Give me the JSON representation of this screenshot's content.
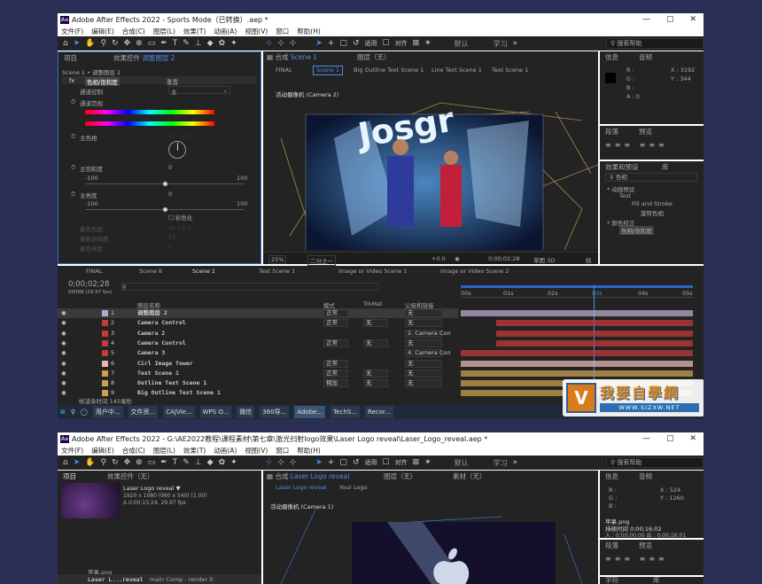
{
  "win1": {
    "title": "Adobe After Effects 2022 - Sports Mode（已转换）.aep *",
    "app_icon": "Ae",
    "menu": [
      "文件(F)",
      "编辑(E)",
      "合成(C)",
      "图层(L)",
      "效果(T)",
      "动画(A)",
      "视图(V)",
      "窗口",
      "帮助(H)"
    ],
    "win_buttons": [
      "—",
      "▢",
      "✕"
    ],
    "toolbar": {
      "snap_label": "对齐",
      "align_label": "适用",
      "workspaces": [
        "默认",
        "学习"
      ],
      "search_placeholder": "搜索帮助"
    },
    "fx_panel": {
      "tabs": [
        "项目",
        "效果控件",
        "调整图层 2"
      ],
      "breadcrumb": "Scene 1 • 调整图层 2",
      "effect_name": "色相/饱和度",
      "reset": "重置",
      "channel_control_label": "通道控制",
      "channel_control_value": "主",
      "channel_range_label": "通道范围",
      "master_hue_label": "主色相",
      "master_hue_value": "0x +0.0°",
      "master_sat_label": "主饱和度",
      "master_sat_value": "0",
      "sat_min": "-100",
      "sat_max": "100",
      "master_light_label": "主亮度",
      "master_light_value": "0",
      "light_min": "-100",
      "light_max": "100",
      "colorize_label": "彩色化",
      "colorize_hue_label": "着色色相",
      "colorize_hue_value": "0x +0.0°",
      "colorize_sat_label": "着色饱和度",
      "colorize_sat_value": "25",
      "colorize_light_label": "着色亮度",
      "colorize_light_value": "0"
    },
    "comp": {
      "header": "合成",
      "header_comp": "Scene 1",
      "layer_label": "图层（无）",
      "tabs": [
        "FINAL",
        "Scene 1",
        "Big Outline Text Scene 1",
        "Line Text Scene 1",
        "Text Scene 1"
      ],
      "camera_label": "活动摄像机 (Camera 2)",
      "zoom": "25%",
      "quality": "二分之一",
      "offset": "+0.0",
      "timecode": "0;00;02;28",
      "draft": "草图 3D",
      "last": "经"
    },
    "info": {
      "tabs": [
        "信息",
        "音频"
      ],
      "R": "R :",
      "G": "G :",
      "B": "B :",
      "A": "A : 0",
      "X": "X : 3192",
      "Y": "Y : 344"
    },
    "para": {
      "tabs": [
        "段落",
        "预览"
      ]
    },
    "effects": {
      "tabs": [
        "效果和预设",
        "库"
      ],
      "search": "色相",
      "items": [
        "* 动画预设",
        "Text",
        "Fill and Stroke",
        "旋转色相",
        "* 颜色校正",
        "色相/饱和度"
      ]
    },
    "timeline": {
      "tabs": [
        "FINAL",
        "Scene 8",
        "Scene 1",
        "Text Scene 1",
        "Image or Video Scene 1",
        "Image or Video Scene 2"
      ],
      "timecode": "0;00;02;28",
      "fps": "00088 (29.97 fps)",
      "cols": {
        "name": "图层名称",
        "mode": "模式",
        "trk": "TrkMat",
        "parent": "父级和链接"
      },
      "ruler": [
        "00s",
        "01s",
        "02s",
        "03s",
        "04s",
        "05s"
      ],
      "footer": "帧渲染时间  145毫秒",
      "layers": [
        {
          "n": "1",
          "name": "调整图层 2",
          "mode": "正常",
          "trk": "",
          "parent": "无",
          "color": "#b9a9c9"
        },
        {
          "n": "2",
          "name": "Camera Control",
          "mode": "正常",
          "trk": "无",
          "parent": "无",
          "color": "#c33b3b"
        },
        {
          "n": "3",
          "name": "Camera 2",
          "mode": "",
          "trk": "",
          "parent": "2. Camera Con",
          "color": "#c33b3b"
        },
        {
          "n": "4",
          "name": "Camera Control",
          "mode": "正常",
          "trk": "无",
          "parent": "无",
          "color": "#c33b3b"
        },
        {
          "n": "5",
          "name": "Camera 3",
          "mode": "",
          "trk": "",
          "parent": "4. Camera Con",
          "color": "#c33b3b"
        },
        {
          "n": "6",
          "name": "Cirl Image Tower",
          "mode": "正常",
          "trk": "",
          "parent": "无",
          "color": "#e8b4b4"
        },
        {
          "n": "7",
          "name": "Text Scene 1",
          "mode": "正常",
          "trk": "无",
          "parent": "无",
          "color": "#c8a050"
        },
        {
          "n": "8",
          "name": "Outline Text Scene 1",
          "mode": "相加",
          "trk": "无",
          "parent": "无",
          "color": "#c8a050"
        },
        {
          "n": "9",
          "name": "Big Outline Text Scene 1",
          "mode": "",
          "trk": "",
          "parent": "",
          "color": "#c8a050"
        }
      ]
    },
    "taskbar": [
      "用户中...",
      "文件资...",
      "CAJVie...",
      "WPS O...",
      "微信",
      "360导...",
      "Adobe...",
      "TechS...",
      "Recor..."
    ]
  },
  "win2": {
    "title": "Adobe After Effects 2022 - G:\\AE2022教程\\课程素材\\第七章\\激光扫射logo效果\\Laser Logo reveal\\Laser_Logo_reveal.aep *",
    "menu": [
      "文件(F)",
      "编辑(E)",
      "合成(C)",
      "图层(L)",
      "效果(T)",
      "动画(A)",
      "视图(V)",
      "窗口",
      "帮助(H)"
    ],
    "project": {
      "tabs": [
        "项目",
        "效果控件（无）"
      ],
      "comp_name": "Laser Logo reveal ▼",
      "comp_size": "1920 x 1080 (960 x 540) (1.00)",
      "comp_dur": "Δ 0;00;15;24, 29.97 fps",
      "cols": {
        "name": "名称",
        "note": "注释"
      },
      "items": [
        {
          "name": "苹果.png",
          "note": ""
        },
        {
          "name": "Laser L...reveal",
          "note": "main Comp - render it"
        }
      ]
    },
    "comp": {
      "header": "合成",
      "header_comp": "Laser Logo reveal",
      "layer_label": "图层（无）",
      "footage": "素材（无）",
      "tabs": [
        "Laser Logo reveal",
        "Your Logo"
      ],
      "camera": "活动摄像机 (Camera 1)"
    },
    "info": {
      "tabs": [
        "信息",
        "音频"
      ],
      "X": "X : 524",
      "Y": "Y : 1260",
      "file": "苹果.png",
      "used": "持续时间 0;00;16;02",
      "io": "入 : 0;00;00;00   出 : 0;00;16;01"
    },
    "para": {
      "tabs": [
        "段落",
        "预览"
      ]
    },
    "bottom": [
      "字符",
      "库"
    ]
  },
  "watermark": {
    "title": "我要自學網",
    "url": "WWW.SIZXW.NET",
    "logo": "V"
  },
  "colors": {
    "accent": "#2d8ceb",
    "bg": "#232323",
    "page": "#2b2f55"
  }
}
